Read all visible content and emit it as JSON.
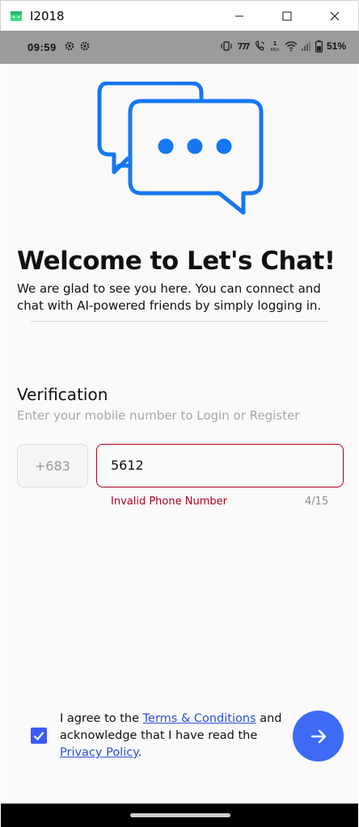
{
  "window": {
    "title": "I2018",
    "app_icon": "android-icon",
    "accent": "#3ddc84"
  },
  "status_bar": {
    "time": "09:59",
    "icons_left": [
      "gear-icon",
      "gear-icon"
    ],
    "icons_right": [
      "vibrate-icon",
      "volte-icon",
      "wifi-calling-icon",
      "data-speed-icon",
      "wifi-icon",
      "signal-icon",
      "battery-icon"
    ],
    "data_speed": "1 KB/s",
    "battery": "51%"
  },
  "hero": {
    "icon": "chat-bubbles-icon",
    "color": "#1677f2"
  },
  "welcome": {
    "title": "Welcome to Let's Chat!",
    "subtitle": "We are glad to see you here. You can connect and chat with AI-powered friends by simply logging in."
  },
  "verification": {
    "title": "Verification",
    "subtitle": "Enter your mobile number to Login or Register",
    "country_code": "+683",
    "phone_value": "5612",
    "error": "Invalid Phone Number",
    "counter": "4/15",
    "error_color": "#b00020"
  },
  "agreement": {
    "checked": true,
    "text_1": "I agree to the ",
    "terms_link": "Terms & Conditions",
    "text_2": " and acknowledge that I have read the ",
    "privacy_link": "Privacy Policy",
    "text_3": ".",
    "accent": "#3d5afe"
  },
  "submit": {
    "icon": "arrow-right-icon",
    "color": "#3d6bf5"
  }
}
